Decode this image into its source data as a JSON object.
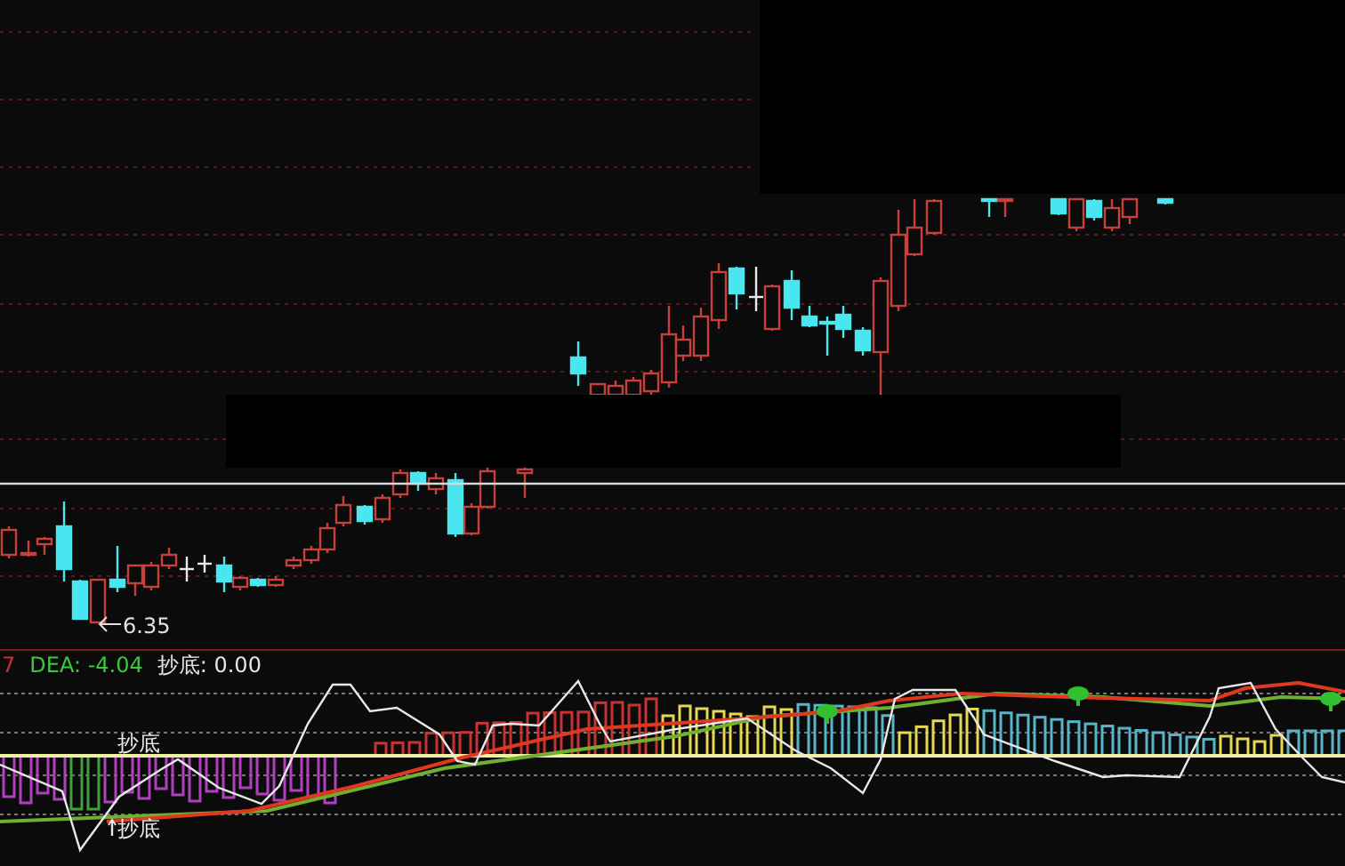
{
  "main_chart": {
    "low_marker": "6.35"
  },
  "indicator_legend": [
    {
      "label": "7",
      "color": "#c83232"
    },
    {
      "label": "DEA: -4.04",
      "color": "#3cc83c"
    },
    {
      "label": "抄底: 0.00",
      "color": "#e6e6e6"
    }
  ],
  "indicator_chart": {
    "signal_labels": [
      {
        "text": "抄底",
        "kind": "plain"
      },
      {
        "text": "抄底",
        "kind": "arrow"
      }
    ]
  }
}
